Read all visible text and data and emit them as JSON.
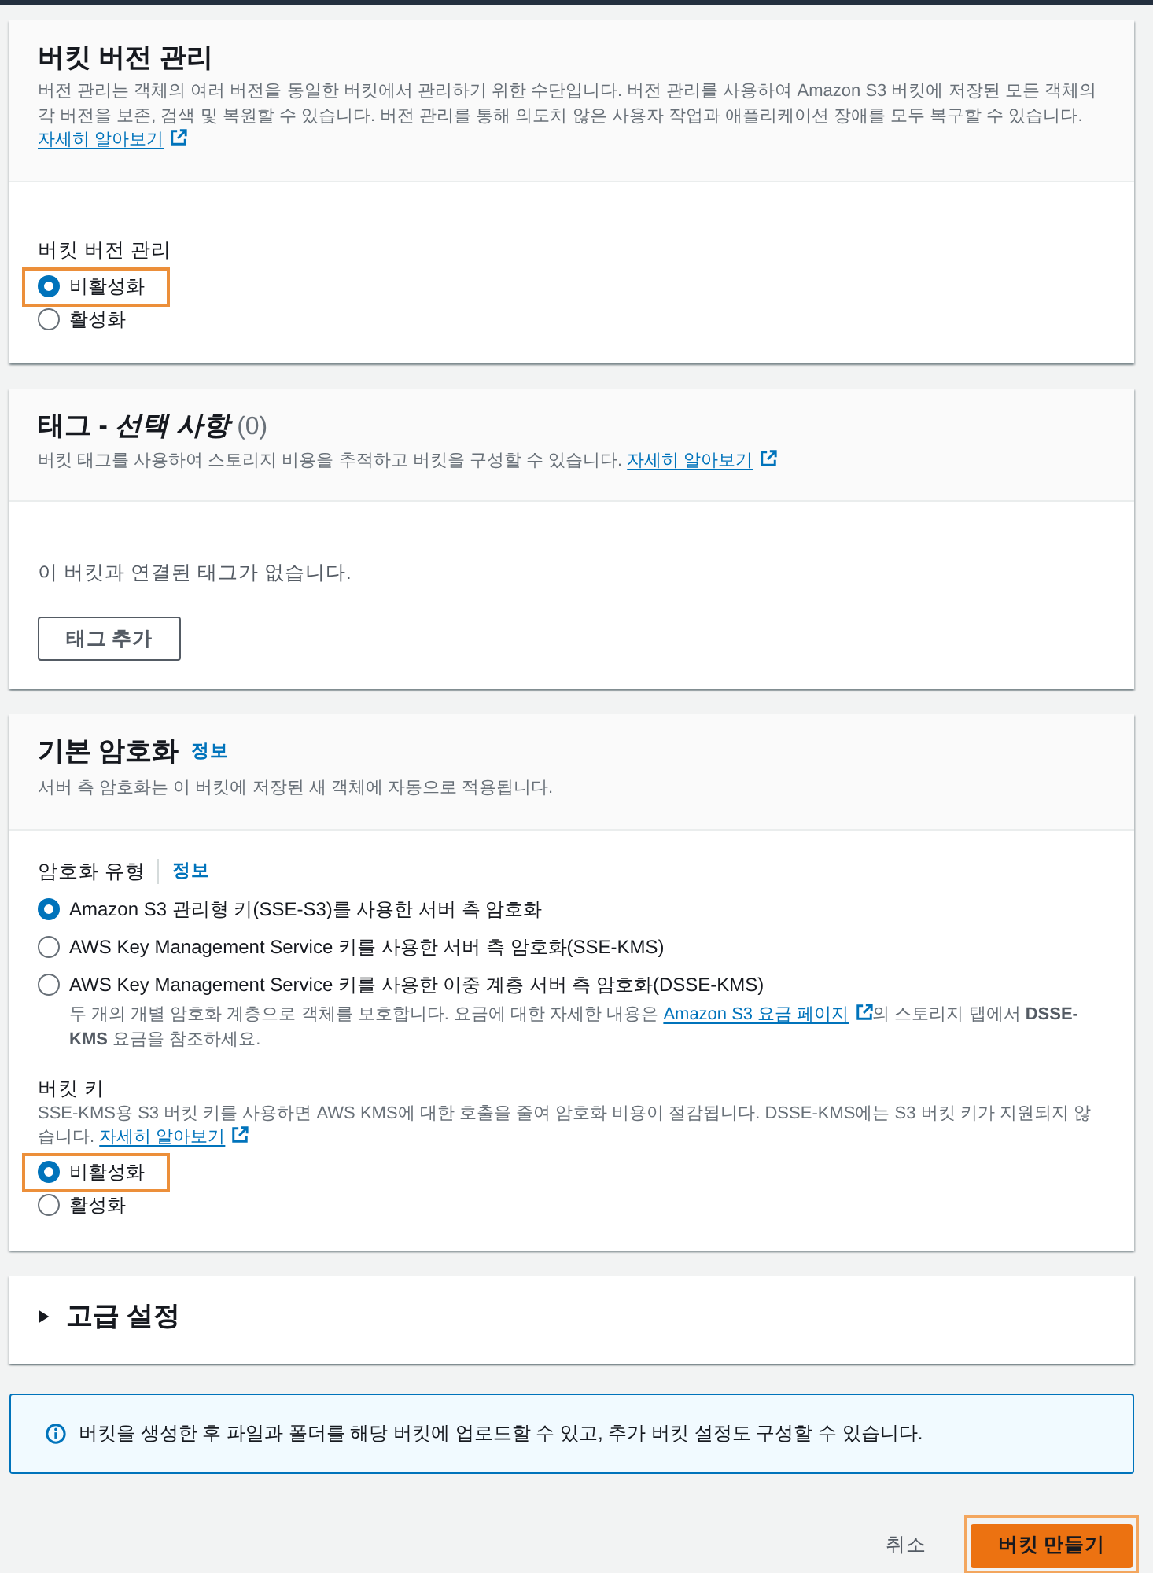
{
  "versioning": {
    "title": "버킷 버전 관리",
    "description": "버전 관리는 객체의 여러 버전을 동일한 버킷에서 관리하기 위한 수단입니다. 버전 관리를 사용하여 Amazon S3 버킷에 저장된 모든 객체의 각 버전을 보존, 검색 및 복원할 수 있습니다. 버전 관리를 통해 의도치 않은 사용자 작업과 애플리케이션 장애를 모두 복구할 수 있습니다.",
    "link": "자세히 알아보기",
    "field_label": "버킷 버전 관리",
    "options": [
      {
        "label": "비활성화",
        "selected": true,
        "highlighted": true
      },
      {
        "label": "활성화",
        "selected": false,
        "highlighted": false
      }
    ]
  },
  "tags": {
    "title": "태그 - *선택 사항*",
    "count": "(0)",
    "description": "버킷 태그를 사용하여 스토리지 비용을 추적하고 버킷을 구성할 수 있습니다.",
    "link": "자세히 알아보기",
    "empty_text": "이 버킷과 연결된 태그가 없습니다.",
    "add_button": "태그 추가"
  },
  "encryption": {
    "title": "기본 암호화",
    "info": "정보",
    "description": "서버 측 암호화는 이 버킷에 저장된 새 객체에 자동으로 적용됩니다.",
    "type_label": "암호화 유형",
    "type_info": "정보",
    "type_options": [
      {
        "label": "Amazon S3 관리형 키(SSE-S3)를 사용한 서버 측 암호화",
        "selected": true,
        "highlighted": false
      },
      {
        "label": "AWS Key Management Service 키를 사용한 서버 측 암호화(SSE-KMS)",
        "selected": false,
        "highlighted": false
      },
      {
        "label": "AWS Key Management Service 키를 사용한 이중 계층 서버 측 암호화(DSSE-KMS)",
        "selected": false,
        "highlighted": false,
        "note": {
          "before": "두 개의 개별 암호화 계층으로 객체를 보호합니다. 요금에 대한 자세한 내용은",
          "link": "Amazon S3 요금 페이지",
          "after": "의 스토리지 탭에서 **DSSE-KMS** 요금을 참조하세요."
        }
      }
    ],
    "bucket_key": {
      "label": "버킷 키",
      "description": "SSE-KMS용 S3 버킷 키를 사용하면 AWS KMS에 대한 호출을 줄여 암호화 비용이 절감됩니다. DSSE-KMS에는 S3 버킷 키가 지원되지 않습니다.",
      "link": "자세히 알아보기",
      "options": [
        {
          "label": "비활성화",
          "selected": true,
          "highlighted": true
        },
        {
          "label": "활성화",
          "selected": false,
          "highlighted": false
        }
      ]
    }
  },
  "advanced": {
    "title": "고급 설정",
    "expanded": false
  },
  "info_alert": {
    "text": "버킷을 생성한 후 파일과 폴더를 해당 버킷에 업로드할 수 있고, 추가 버킷 설정도 구성할 수 있습니다."
  },
  "actions": [
    {
      "kind": "text",
      "label": "취소",
      "highlighted": false
    },
    {
      "kind": "primary",
      "label": "버킷 만들기",
      "highlighted": true
    }
  ]
}
